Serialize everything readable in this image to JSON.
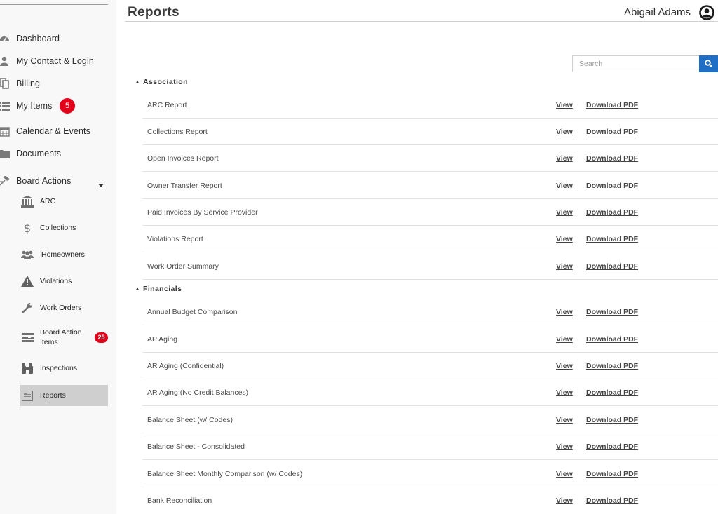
{
  "header": {
    "title": "Reports",
    "user_name": "Abigail Adams"
  },
  "sidebar": {
    "items": [
      {
        "label": "Dashboard",
        "icon": "dashboard-icon"
      },
      {
        "label": "My Contact & Login",
        "icon": "user-icon"
      },
      {
        "label": "Billing",
        "icon": "billing-icon"
      },
      {
        "label": "My Items",
        "icon": "list-icon",
        "badge": "5"
      },
      {
        "label": "Calendar & Events",
        "icon": "calendar-icon"
      },
      {
        "label": "Documents",
        "icon": "folder-icon"
      },
      {
        "label": "Board Actions",
        "icon": "gavel-icon"
      }
    ],
    "board_actions": [
      {
        "label": "ARC",
        "icon": "bank-icon"
      },
      {
        "label": "Collections",
        "icon": "dollar-icon"
      },
      {
        "label": "Homeowners",
        "icon": "users-icon"
      },
      {
        "label": "Violations",
        "icon": "warning-icon"
      },
      {
        "label": "Work Orders",
        "icon": "wrench-icon"
      },
      {
        "label": "Board Action Items",
        "icon": "tasks-icon",
        "badge": "25"
      },
      {
        "label": "Inspections",
        "icon": "binoculars-icon"
      },
      {
        "label": "Reports",
        "icon": "report-icon",
        "active": true
      }
    ]
  },
  "search": {
    "placeholder": "Search"
  },
  "links": {
    "view": "View",
    "download": "Download PDF"
  },
  "sections": [
    {
      "title": "Association",
      "reports": [
        "ARC Report",
        "Collections Report",
        "Open Invoices Report",
        "Owner Transfer Report",
        "Paid Invoices By Service Provider",
        "Violations Report",
        "Work Order Summary"
      ]
    },
    {
      "title": "Financials",
      "reports": [
        "Annual Budget Comparison",
        "AP Aging",
        "AR Aging (Confidential)",
        "AR Aging (No Credit Balances)",
        "Balance Sheet (w/ Codes)",
        "Balance Sheet - Consolidated",
        "Balance Sheet Monthly Comparison (w/ Codes)",
        "Bank Reconciliation"
      ]
    }
  ],
  "colors": {
    "badge": "#e2001a",
    "search_button": "#1f6fc7",
    "active_nav": "#cfcfcf"
  }
}
